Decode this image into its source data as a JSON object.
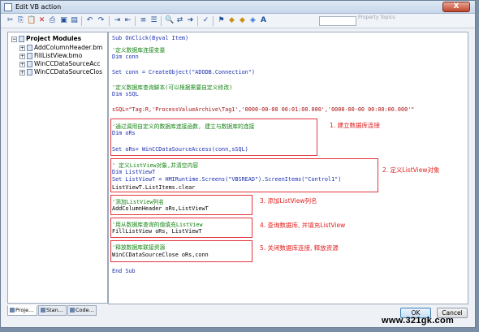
{
  "window": {
    "title": "Edit VB action",
    "close_glyph": "X"
  },
  "toolbar": {
    "icons": [
      "cut-icon",
      "copy-icon",
      "paste-icon",
      "delete-icon",
      "print-icon",
      "undo-icon",
      "redo-icon",
      "indent-icon",
      "outdent-icon",
      "comment-icon",
      "uncomment-icon",
      "find-icon",
      "replace-icon",
      "goto-icon",
      "check-syntax-icon",
      "bookmark-icon",
      "prev-bookmark-icon",
      "next-bookmark-icon",
      "font-icon"
    ]
  },
  "background_window_text": "Property Topics",
  "sidebar": {
    "root": "Project Modules",
    "items": [
      {
        "label": "AddColumnHeader.bm"
      },
      {
        "label": "FillListView.bmo"
      },
      {
        "label": "WinCCDataSourceAcc"
      },
      {
        "label": "WinCCDataSourceClos"
      }
    ],
    "tabs": [
      "Proje...",
      "Stan...",
      "Code..."
    ]
  },
  "code": {
    "lines": [
      "Sub OnClick(Byval Item)",
      "'定义数据库连接变量",
      "Dim conn",
      "Set conn = CreateObject(\"ADODB.Connection\")",
      "'定义数据库查询脚本(可以根据需要自定义修改)",
      "Dim sSQL",
      "sSQL=\"Tag:R,'ProcessValueArchive\\Tag1','0000-00-00 00:01:00.000','0000-00-00 00:00:00.000'\"",
      "'通过调用自定义的数据库连接函数, 建立与数据库的连接",
      "Dim oRs",
      "Set oRs= WinCCDataSourceAccess(conn,sSQL)",
      "' 定义ListView对象,并清空内容",
      "Dim ListViewT",
      "Set ListViewT = HMIRuntime.Screens(\"VBSREAD\").ScreenItems(\"Control1\")",
      "ListViewT.ListItems.clear",
      "'添加ListView列名",
      "AddColumnHeader oRs,ListViewT",
      "'用从数据库查询的值填充ListView",
      "FillListView oRs, ListViewT",
      "'释放数据库联接资源",
      "WinCCDataSourceClose oRs,conn",
      "End Sub"
    ]
  },
  "annotations": [
    "1. 建立数据库连接",
    "2. 定义ListView对象",
    "3. 添加ListView列名",
    "4. 查询数据库, 并填充ListView",
    "5. 关闭数据库连接, 释放资源"
  ],
  "buttons": {
    "ok": "OK",
    "cancel": "Cancel"
  },
  "watermark": "www.321gk.com",
  "colors": {
    "keyword": "#1a2fb0",
    "comment": "#148414",
    "string": "#a11111",
    "highlight": "#e2353d"
  }
}
